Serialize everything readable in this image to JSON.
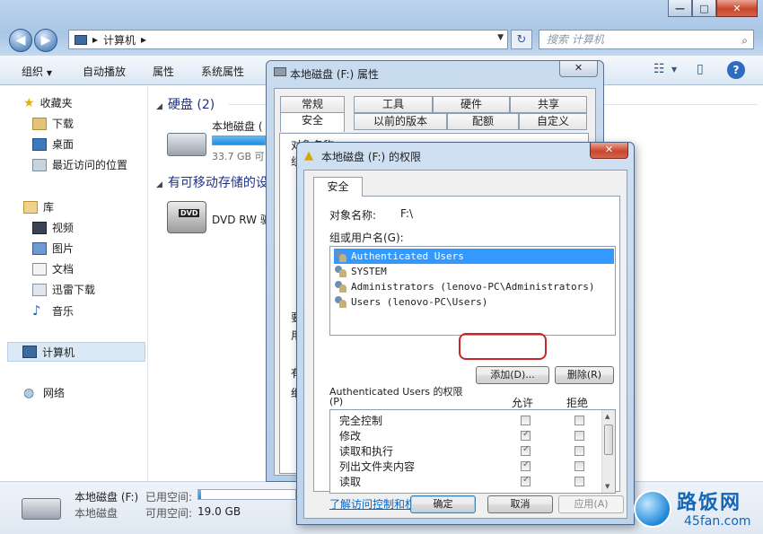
{
  "explorer": {
    "window_controls": [
      "—",
      "□",
      "✕"
    ],
    "address": {
      "computer": "计算机"
    },
    "search_placeholder": "搜索 计算机",
    "toolbar": [
      "组织",
      "自动播放",
      "属性",
      "系统属性"
    ],
    "sidebar": {
      "favorites": "收藏夹",
      "favorites_items": [
        "下载",
        "桌面",
        "最近访问的位置"
      ],
      "libraries": "库",
      "library_items": [
        "视频",
        "图片",
        "文档",
        "迅雷下载",
        "音乐"
      ],
      "computer": "计算机",
      "network": "网络"
    },
    "groups": {
      "hdd_title": "硬盘 (2)",
      "removable_title": "有可移动存储的设"
    },
    "drive_fragment": "本地磁盘 (",
    "drive_size": "33.7 GB 可",
    "dvd_badge": "DVD",
    "dvd_label": "DVD RW 驱",
    "status": {
      "name": "本地磁盘 (F:)",
      "type": "本地磁盘",
      "used_label": "已用空间:",
      "free_label": "可用空间:",
      "free_value": "19.0 GB",
      "used_fraction": 0.03
    }
  },
  "properties_dialog": {
    "title": "本地磁盘 (F:) 属性",
    "close": "✕",
    "tabs_row1": [
      "常规",
      "工具",
      "硬件",
      "共享"
    ],
    "tabs_row2": [
      "安全",
      "以前的版本",
      "配额",
      "自定义"
    ],
    "fragments": [
      "对象名称",
      "组",
      "要",
      "用",
      "有",
      "细"
    ]
  },
  "permissions_dialog": {
    "title": "本地磁盘 (F:) 的权限",
    "close": "✕",
    "tab": "安全",
    "object_label": "对象名称:",
    "object_value": "F:\\",
    "group_label": "组或用户名(G):",
    "users": [
      "Authenticated Users",
      "SYSTEM",
      "Administrators (lenovo-PC\\Administrators)",
      "Users (lenovo-PC\\Users)"
    ],
    "add_button": "添加(D)...",
    "remove_button": "删除(R)",
    "perm_header_line1": "Authenticated Users 的权限",
    "perm_header_line2": "(P)",
    "allow": "允许",
    "deny": "拒绝",
    "permissions": [
      {
        "name": "完全控制",
        "allow": false,
        "deny": false
      },
      {
        "name": "修改",
        "allow": true,
        "deny": false
      },
      {
        "name": "读取和执行",
        "allow": true,
        "deny": false
      },
      {
        "name": "列出文件夹内容",
        "allow": true,
        "deny": false
      },
      {
        "name": "读取",
        "allow": true,
        "deny": false
      }
    ],
    "link": "了解访问控制和权限",
    "ok": "确定",
    "cancel": "取消",
    "apply": "应用(A)"
  },
  "watermark": {
    "cn": "路饭网",
    "en": "45fan.com"
  }
}
